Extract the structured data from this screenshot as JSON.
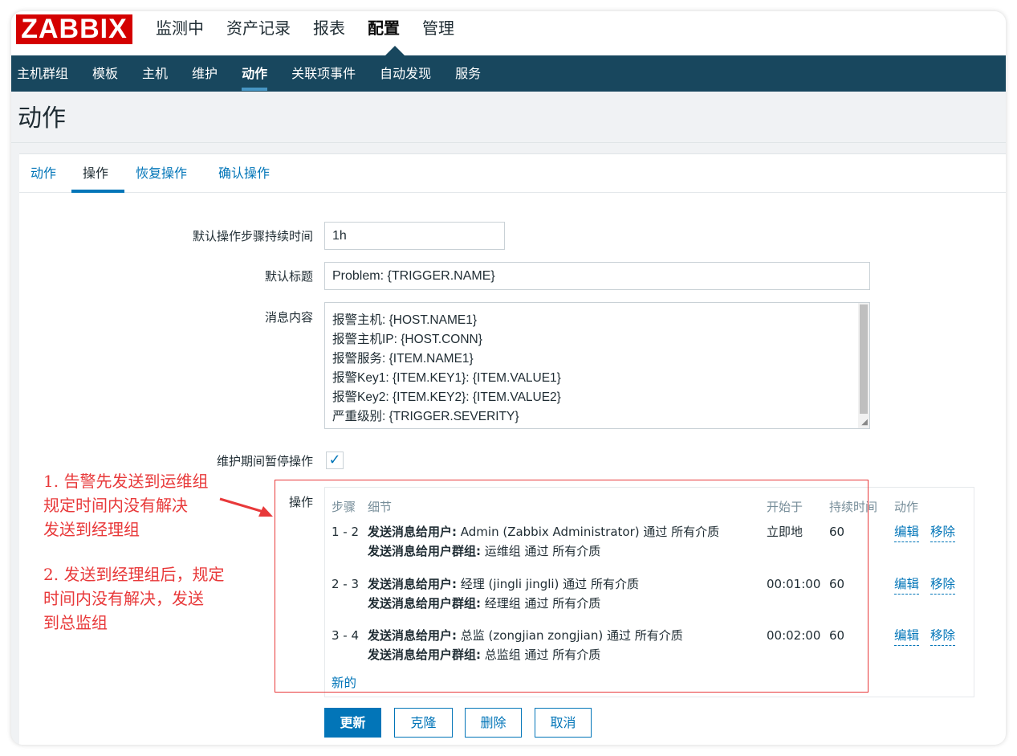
{
  "app": {
    "logo": "ZABBIX"
  },
  "main_nav": [
    {
      "label": "监测中",
      "active": false
    },
    {
      "label": "资产记录",
      "active": false
    },
    {
      "label": "报表",
      "active": false
    },
    {
      "label": "配置",
      "active": true
    },
    {
      "label": "管理",
      "active": false
    }
  ],
  "sub_nav": [
    {
      "label": "主机群组",
      "active": false
    },
    {
      "label": "模板",
      "active": false
    },
    {
      "label": "主机",
      "active": false
    },
    {
      "label": "维护",
      "active": false
    },
    {
      "label": "动作",
      "active": true
    },
    {
      "label": "关联项事件",
      "active": false
    },
    {
      "label": "自动发现",
      "active": false
    },
    {
      "label": "服务",
      "active": false
    }
  ],
  "page_title": "动作",
  "tabs": [
    {
      "label": "动作",
      "active": false
    },
    {
      "label": "操作",
      "active": true
    },
    {
      "label": "恢复操作",
      "active": false
    },
    {
      "label": "确认操作",
      "active": false
    }
  ],
  "form": {
    "step_duration_label": "默认操作步骤持续时间",
    "step_duration_value": "1h",
    "default_subject_label": "默认标题",
    "default_subject_value": "Problem: {TRIGGER.NAME}",
    "message_label": "消息内容",
    "message_lines": [
      "报警主机: {HOST.NAME1}",
      "报警主机IP: {HOST.CONN}",
      "报警服务: {ITEM.NAME1}",
      "报警Key1: {ITEM.KEY1}:  {ITEM.VALUE1}",
      "报警Key2: {ITEM.KEY2}:  {ITEM.VALUE2}",
      "严重级别: {TRIGGER.SEVERITY}"
    ],
    "pause_label": "维护期间暂停操作",
    "pause_checked": true,
    "operations_label": "操作"
  },
  "operations": {
    "headers": {
      "steps": "步骤",
      "details": "细节",
      "start_in": "开始于",
      "duration": "持续时间",
      "action": "动作"
    },
    "rows": [
      {
        "steps": "1 - 2",
        "user_prefix": "发送消息给用户:",
        "user_text": " Admin (Zabbix Administrator) 通过 所有介质",
        "group_prefix": "发送消息给用户群组:",
        "group_text": " 运维组 通过 所有介质",
        "start_in": "立即地",
        "duration": "60",
        "edit": "编辑",
        "remove": "移除"
      },
      {
        "steps": "2 - 3",
        "user_prefix": "发送消息给用户:",
        "user_text": " 经理 (jingli jingli) 通过 所有介质",
        "group_prefix": "发送消息给用户群组:",
        "group_text": " 经理组 通过 所有介质",
        "start_in": "00:01:00",
        "duration": "60",
        "edit": "编辑",
        "remove": "移除"
      },
      {
        "steps": "3 - 4",
        "user_prefix": "发送消息给用户:",
        "user_text": " 总监 (zongjian zongjian) 通过 所有介质",
        "group_prefix": "发送消息给用户群组:",
        "group_text": " 总监组 通过 所有介质",
        "start_in": "00:02:00",
        "duration": "60",
        "edit": "编辑",
        "remove": "移除"
      }
    ],
    "new_link": "新的"
  },
  "annotation": {
    "lines": [
      "1. 告警先发送到运维组",
      "规定时间内没有解决",
      "发送到经理组",
      "",
      "2. 发送到经理组后，规定",
      "时间内没有解决，发送",
      "到总监组"
    ],
    "color": "#e8393a"
  },
  "buttons": {
    "update": "更新",
    "clone": "克隆",
    "delete": "删除",
    "cancel": "取消"
  },
  "colors": {
    "nav_bg": "#18475e",
    "link": "#0275b8",
    "logo_bg": "#d40000"
  }
}
